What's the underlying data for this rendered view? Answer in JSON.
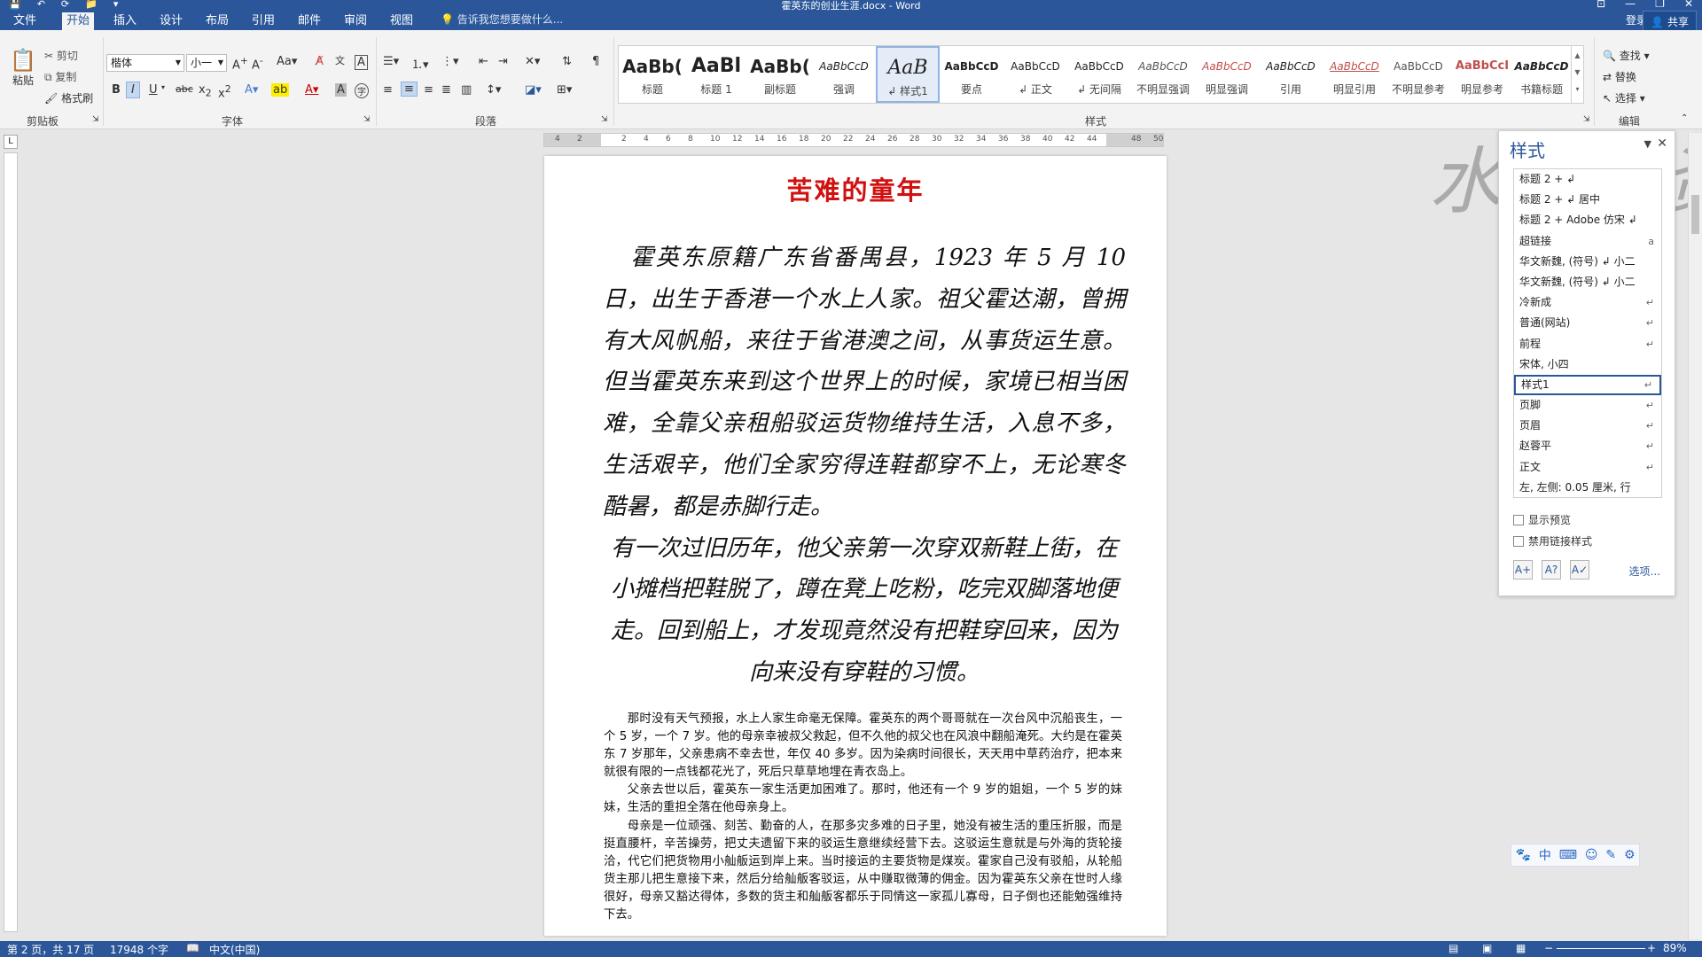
{
  "window": {
    "title": "霍英东的创业生涯.docx - Word",
    "qat": [
      "💾",
      "↶",
      "⟳",
      "📁",
      "▾"
    ],
    "controls": [
      "⊡",
      "—",
      "❐",
      "✕"
    ]
  },
  "tabs": {
    "file": "文件",
    "items": [
      "开始",
      "插入",
      "设计",
      "布局",
      "引用",
      "邮件",
      "审阅",
      "视图"
    ],
    "tellme": "告诉我您想要做什么...",
    "login": "登录",
    "share": "共享"
  },
  "ribbon": {
    "clipboard": {
      "paste": "粘贴",
      "cut": "剪切",
      "copy": "复制",
      "format_painter": "格式刷",
      "label": "剪贴板"
    },
    "font": {
      "name": "楷体",
      "size": "小一",
      "label": "字体"
    },
    "paragraph": {
      "label": "段落"
    },
    "styles_label": "样式",
    "editing": {
      "find": "查找",
      "replace": "替换",
      "select": "选择",
      "label": "编辑"
    }
  },
  "gallery": [
    {
      "sample": "AaBb(",
      "name": "标题"
    },
    {
      "sample": "AaBl",
      "name": "标题 1"
    },
    {
      "sample": "AaBb(",
      "name": "副标题"
    },
    {
      "sample": "AaBbCcD",
      "name": "强调"
    },
    {
      "sample": "AaB",
      "name": "↲ 样式1"
    },
    {
      "sample": "AaBbCcD",
      "name": "要点"
    },
    {
      "sample": "AaBbCcD",
      "name": "↲ 正文"
    },
    {
      "sample": "AaBbCcD",
      "name": "↲ 无间隔"
    },
    {
      "sample": "AaBbCcD",
      "name": "不明显强调"
    },
    {
      "sample": "AaBbCcD",
      "name": "明显强调"
    },
    {
      "sample": "AaBbCcD",
      "name": "引用"
    },
    {
      "sample": "AaBbCcD",
      "name": "明显引用"
    },
    {
      "sample": "AaBbCcD",
      "name": "不明显参考"
    },
    {
      "sample": "AaBbCcI",
      "name": "明显参考"
    },
    {
      "sample": "AaBbCcD",
      "name": "书籍标题"
    }
  ],
  "ruler_numbers": [
    "4",
    "2",
    "",
    "2",
    "4",
    "6",
    "8",
    "10",
    "12",
    "14",
    "16",
    "18",
    "20",
    "22",
    "24",
    "26",
    "28",
    "30",
    "32",
    "34",
    "36",
    "38",
    "40",
    "42",
    "44",
    "",
    "48",
    "50"
  ],
  "document": {
    "title": "苦难的童年",
    "big_paragraphs": [
      "霍英东原籍广东省番禺县，1923 年 5 月 10 日，出生于香港一个水上人家。祖父霍达潮，曾拥有大风帆船，来往于省港澳之间，从事货运生意。但当霍英东来到这个世界上的时候，家境已相当困难，全靠父亲租船驳运货物维持生活，入息不多，生活艰辛，他们全家穷得连鞋都穿不上，无论寒冬酷暑，都是赤脚行走。",
      "有一次过旧历年，他父亲第一次穿双新鞋上街，在小摊档把鞋脱了，蹲在凳上吃粉，吃完双脚落地便走。回到船上，才发现竟然没有把鞋穿回来，因为向来没有穿鞋的习惯。"
    ],
    "small_paragraphs": [
      "那时没有天气预报，水上人家生命毫无保障。霍英东的两个哥哥就在一次台风中沉船丧生，一个 5 岁，一个 7 岁。他的母亲幸被叔父救起，但不久他的叔父也在风浪中翻船淹死。大约是在霍英东 7 岁那年，父亲患病不幸去世，年仅 40 多岁。因为染病时间很长，天天用中草药治疗，把本来就很有限的一点钱都花光了，死后只草草地埋在青衣岛上。",
      "父亲去世以后，霍英东一家生活更加困难了。那时，他还有一个 9 岁的姐姐，一个 5 岁的妹妹，生活的重担全落在他母亲身上。",
      "母亲是一位顽强、刻苦、勤奋的人，在那多灾多难的日子里，她没有被生活的重压折服，而是挺直腰杆，辛苦操劳，把丈夫遗留下来的驳运生意继续经营下去。这驳运生意就是与外海的货轮接洽，代它们把货物用小舢舨运到岸上来。当时接运的主要货物是煤炭。霍家自己没有驳船，从轮船货主那儿把生意接下来，然后分给舢舨客驳运，从中赚取微薄的佣金。因为霍英东父亲在世时人缘很好，母亲又豁达得体，多数的货主和舢舨客都乐于同情这一家孤儿寡母，日子倒也还能勉强维持下去。"
    ]
  },
  "watermark": "水利考资",
  "styles_pane": {
    "title": "样式",
    "items": [
      {
        "name": "标题 2 + ↲",
        "mark": ""
      },
      {
        "name": "标题 2 + ↲ 居中",
        "mark": ""
      },
      {
        "name": "标题 2 + Adobe 仿宋 ↲",
        "mark": ""
      },
      {
        "name": "超链接",
        "mark": "a"
      },
      {
        "name": "华文新魏, (符号) ↲ 小二",
        "mark": ""
      },
      {
        "name": "华文新魏, (符号) ↲ 小二",
        "mark": ""
      },
      {
        "name": "冷新成",
        "mark": "↵"
      },
      {
        "name": "普通(网站)",
        "mark": "↵"
      },
      {
        "name": "前程",
        "mark": "↵"
      },
      {
        "name": "宋体, 小四",
        "mark": ""
      },
      {
        "name": "样式1",
        "mark": "↵"
      },
      {
        "name": "页脚",
        "mark": "↵"
      },
      {
        "name": "页眉",
        "mark": "↵"
      },
      {
        "name": "赵蓉平",
        "mark": "↵"
      },
      {
        "name": "正文",
        "mark": "↵"
      },
      {
        "name": "左, 左侧: 0.05 厘米, 行",
        "mark": ""
      }
    ],
    "selected_index": 10,
    "show_preview": "显示预览",
    "disable_linked": "禁用链接样式",
    "options": "选项..."
  },
  "ime": [
    "🐾",
    "中",
    "⌨",
    "☺",
    "✎",
    "⚙"
  ],
  "status": {
    "page": "第 2 页，共 17 页",
    "words": "17948 个字",
    "lang": "中文(中国)",
    "zoom": "89%"
  }
}
